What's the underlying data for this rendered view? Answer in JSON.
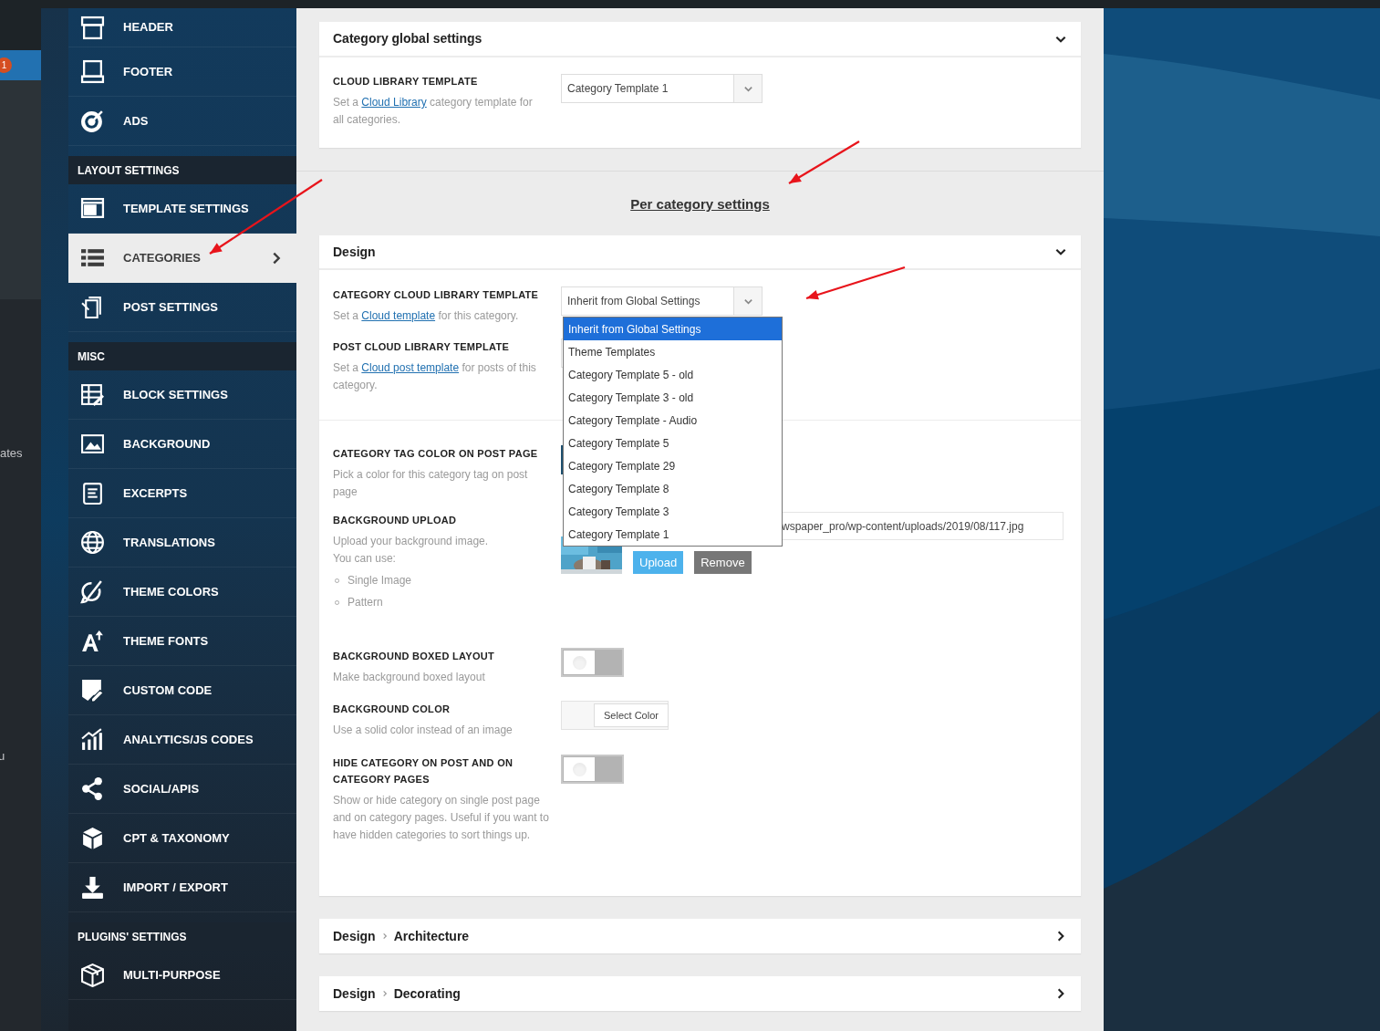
{
  "admin_menu": {
    "badge": "1",
    "labels": [
      "ates",
      "u"
    ]
  },
  "sidebar": {
    "items": [
      {
        "kind": "item",
        "label": "HEADER",
        "selected": false
      },
      {
        "kind": "item",
        "label": "FOOTER",
        "selected": false
      },
      {
        "kind": "item",
        "label": "ADS",
        "selected": false
      },
      {
        "kind": "section",
        "label": "LAYOUT SETTINGS"
      },
      {
        "kind": "item",
        "label": "TEMPLATE SETTINGS",
        "selected": false
      },
      {
        "kind": "item",
        "label": "CATEGORIES",
        "selected": true
      },
      {
        "kind": "item",
        "label": "POST SETTINGS",
        "selected": false
      },
      {
        "kind": "section",
        "label": "MISC"
      },
      {
        "kind": "item",
        "label": "BLOCK SETTINGS",
        "selected": false
      },
      {
        "kind": "item",
        "label": "BACKGROUND",
        "selected": false
      },
      {
        "kind": "item",
        "label": "EXCERPTS",
        "selected": false
      },
      {
        "kind": "item",
        "label": "TRANSLATIONS",
        "selected": false
      },
      {
        "kind": "item",
        "label": "THEME COLORS",
        "selected": false
      },
      {
        "kind": "item",
        "label": "THEME FONTS",
        "selected": false
      },
      {
        "kind": "item",
        "label": "CUSTOM CODE",
        "selected": false
      },
      {
        "kind": "item",
        "label": "ANALYTICS/JS CODES",
        "selected": false
      },
      {
        "kind": "item",
        "label": "SOCIAL/APIS",
        "selected": false
      },
      {
        "kind": "item",
        "label": "CPT & TAXONOMY",
        "selected": false
      },
      {
        "kind": "item",
        "label": "IMPORT / EXPORT",
        "selected": false
      },
      {
        "kind": "section",
        "label": "PLUGINS' SETTINGS"
      },
      {
        "kind": "item",
        "label": "MULTI-PURPOSE",
        "selected": false
      }
    ]
  },
  "global_panel": {
    "title": "Category global settings",
    "expanded": true,
    "field": {
      "label": "CLOUD LIBRARY TEMPLATE",
      "before": "Set a ",
      "link": "Cloud Library",
      "after": " category template for all categories.",
      "value": "Category Template 1"
    }
  },
  "per_category_title": "Per category settings",
  "design_panel": {
    "title": "Design",
    "expanded": true,
    "fields": [
      {
        "kind": "select",
        "label": "CATEGORY CLOUD LIBRARY TEMPLATE",
        "before": "Set a ",
        "link": "Cloud template",
        "after": " for this category.",
        "value": "Inherit from Global Settings"
      },
      {
        "kind": "select",
        "label": "POST CLOUD LIBRARY TEMPLATE",
        "before": "Set a ",
        "link": "Cloud post template",
        "after": " for posts of this category."
      },
      {
        "kind": "color",
        "label": "CATEGORY TAG COLOR ON POST PAGE",
        "description": "Pick a color for this category tag on post page",
        "color": "#1e4f6e"
      },
      {
        "kind": "upload",
        "label": "BACKGROUND UPLOAD",
        "description": "Upload your background image.",
        "note": "You can use:",
        "bullets": [
          "Single Image",
          "Pattern"
        ],
        "value": "wspaper_pro/wp-content/uploads/2019/08/117.jpg",
        "buttons": [
          "Upload",
          "Remove"
        ]
      },
      {
        "kind": "toggle",
        "label": "BACKGROUND BOXED LAYOUT",
        "description": "Make background boxed layout",
        "on": false
      },
      {
        "kind": "colorpicker",
        "label": "BACKGROUND COLOR",
        "description": "Use a solid color instead of an image",
        "button": "Select Color"
      },
      {
        "kind": "toggle",
        "label": "HIDE CATEGORY ON POST AND ON CATEGORY PAGES",
        "description": "Show or hide category on single post page and on category pages. Useful if you want to have hidden categories to sort things up.",
        "on": false
      }
    ],
    "dropdown": [
      {
        "label": "Inherit from Global Settings",
        "selected": true
      },
      {
        "label": "Theme Templates",
        "selected": false
      },
      {
        "label": "Category Template 5 - old",
        "selected": false
      },
      {
        "label": "Category Template 3 - old",
        "selected": false
      },
      {
        "label": "Category Template - Audio",
        "selected": false
      },
      {
        "label": "Category Template 5",
        "selected": false
      },
      {
        "label": "Category Template 29",
        "selected": false
      },
      {
        "label": "Category Template 8",
        "selected": false
      },
      {
        "label": "Category Template 3",
        "selected": false
      },
      {
        "label": "Category Template 1",
        "selected": false
      }
    ]
  },
  "collapsed_panels": [
    {
      "crumbs": [
        "Design",
        "Architecture"
      ],
      "expanded": false
    },
    {
      "crumbs": [
        "Design",
        "Decorating"
      ],
      "expanded": false
    }
  ]
}
